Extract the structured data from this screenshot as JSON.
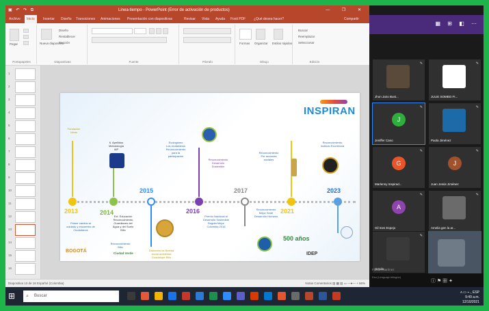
{
  "ppt": {
    "quick_access": "▣ ↶ ↷ ⧉",
    "title": "Linea-tiempo - PowerPoint (Error de activación de productos)",
    "window_controls": "— ❐ ✕",
    "tabs": [
      "Archivo",
      "Inicio",
      "Insertar",
      "Diseño",
      "Transiciones",
      "Animaciones",
      "Presentación con diapositivas",
      "Revisar",
      "Vista",
      "Ayuda",
      "Foxit PDF",
      "¿Qué desea hacer?",
      "Compartir"
    ],
    "ribbon_groups": [
      "Portapapeles",
      "Diapositivas",
      "Fuente",
      "Párrafo",
      "Dibujo",
      "Edición"
    ],
    "ribbon_buttons": {
      "paste": "Pegar",
      "new_slide": "Nueva diapositiva",
      "shapes": "Formas",
      "arrange": "Organizar",
      "quick_styles": "Estilos rápidos",
      "find": "Buscar",
      "replace": "Reemplazar",
      "select": "Seleccionar",
      "design": "Diseño",
      "reset": "Restablecer",
      "section": "Sección"
    },
    "slide_numbers": [
      "1",
      "2",
      "3",
      "4",
      "5",
      "6",
      "7",
      "8",
      "9",
      "10",
      "11",
      "12",
      "13",
      "14",
      "15",
      "16"
    ],
    "status_left": "Diapositiva 13 de 16   Español (Colombia)",
    "status_right": "Notas   Comentarios   ▤ ▦ ▥ ▭   —●—   +  66%"
  },
  "slide": {
    "logo": "INSPIRAN",
    "years": [
      "2013",
      "2014",
      "2015",
      "2016",
      "2017",
      "2021",
      "2023"
    ],
    "top_notes": {
      "y2013": "Fundación\nIdeas",
      "y2014": "6. Apellidos\nMetodología\nIAP",
      "y2015": "Ecologismo\nLos ciudadanos\nReconocimiento\npara la\nparticipación",
      "y2016": "Reconocimiento\nDesarrollo\nSostenible",
      "y2017": "Reconocimiento\nPor acciones\nsociales",
      "y2023": "Reconocimiento\nInstituto Excelencia"
    },
    "bottom_notes": {
      "y2013": "Primer cambio al\ncuidado y encuentro de\nCiudadanos",
      "y2014": "Ext. Educación\nReconocimiento\nGuardianes del\nAgua y del Suelo\nBilio",
      "y2014b": "Reconocimiento\nBilio",
      "y2015": "Distinción de Bebida\nsocial ambiental\nGuadalupe Bilio",
      "y2016": "Premio Nacional al\nDesarrollo Sostenible\nBogotá Mejor\nColombia 2016",
      "y2021": "Reconocimiento\nMejor Sede\nDesarrollo Humano"
    },
    "footer_logos": [
      "BOGOTÁ",
      "Ciudad Verde",
      "500 años",
      "IDEP"
    ]
  },
  "zoom": {
    "controls": "▦ ⊞ ◧ ⋯",
    "participants": [
      {
        "name": "Jhon Jairo Bust...",
        "initial": "",
        "color": "#5a4a3a",
        "photo": true
      },
      {
        "name": "JULIE SOMBO FI...",
        "initial": "",
        "color": "#ffffff",
        "photo": true
      },
      {
        "name": "Jeniffer Cano",
        "initial": "J",
        "color": "#2fae3e",
        "photo": false
      },
      {
        "name": "Paola Jiménez",
        "initial": "",
        "color": "#1c6aa8",
        "photo": true
      },
      {
        "name": "Marlenny Inspirad...",
        "initial": "G",
        "color": "#e8552a",
        "photo": false
      },
      {
        "name": "Juan Jesús Jiménez",
        "initial": "J",
        "color": "#a0522d",
        "photo": false
      },
      {
        "name": "Gil Ines Espejo",
        "initial": "A",
        "color": "#8e44ad",
        "photo": false
      },
      {
        "name": "Amelia gen la ar...",
        "initial": "",
        "color": "#6b6b6b",
        "photo": true
      },
      {
        "name": "Ursula",
        "initial": "",
        "color": "#3a3a3a",
        "photo": true
      },
      {
        "name": "",
        "initial": "",
        "color": "#8a8f95",
        "photo": true
      }
    ],
    "speaker_label": "Fabian Martínez",
    "speaker_sub": "Eso (Lenguaje bilingüe)",
    "bottom_controls": "ⓘ  ⚑  ▦  ✦"
  },
  "taskbar": {
    "search_placeholder": "Buscar",
    "time": "9:49 a.m.",
    "date": "12/10/2021",
    "tray_icons": "ʌ ▭ ⌁ ◟ ESP"
  }
}
